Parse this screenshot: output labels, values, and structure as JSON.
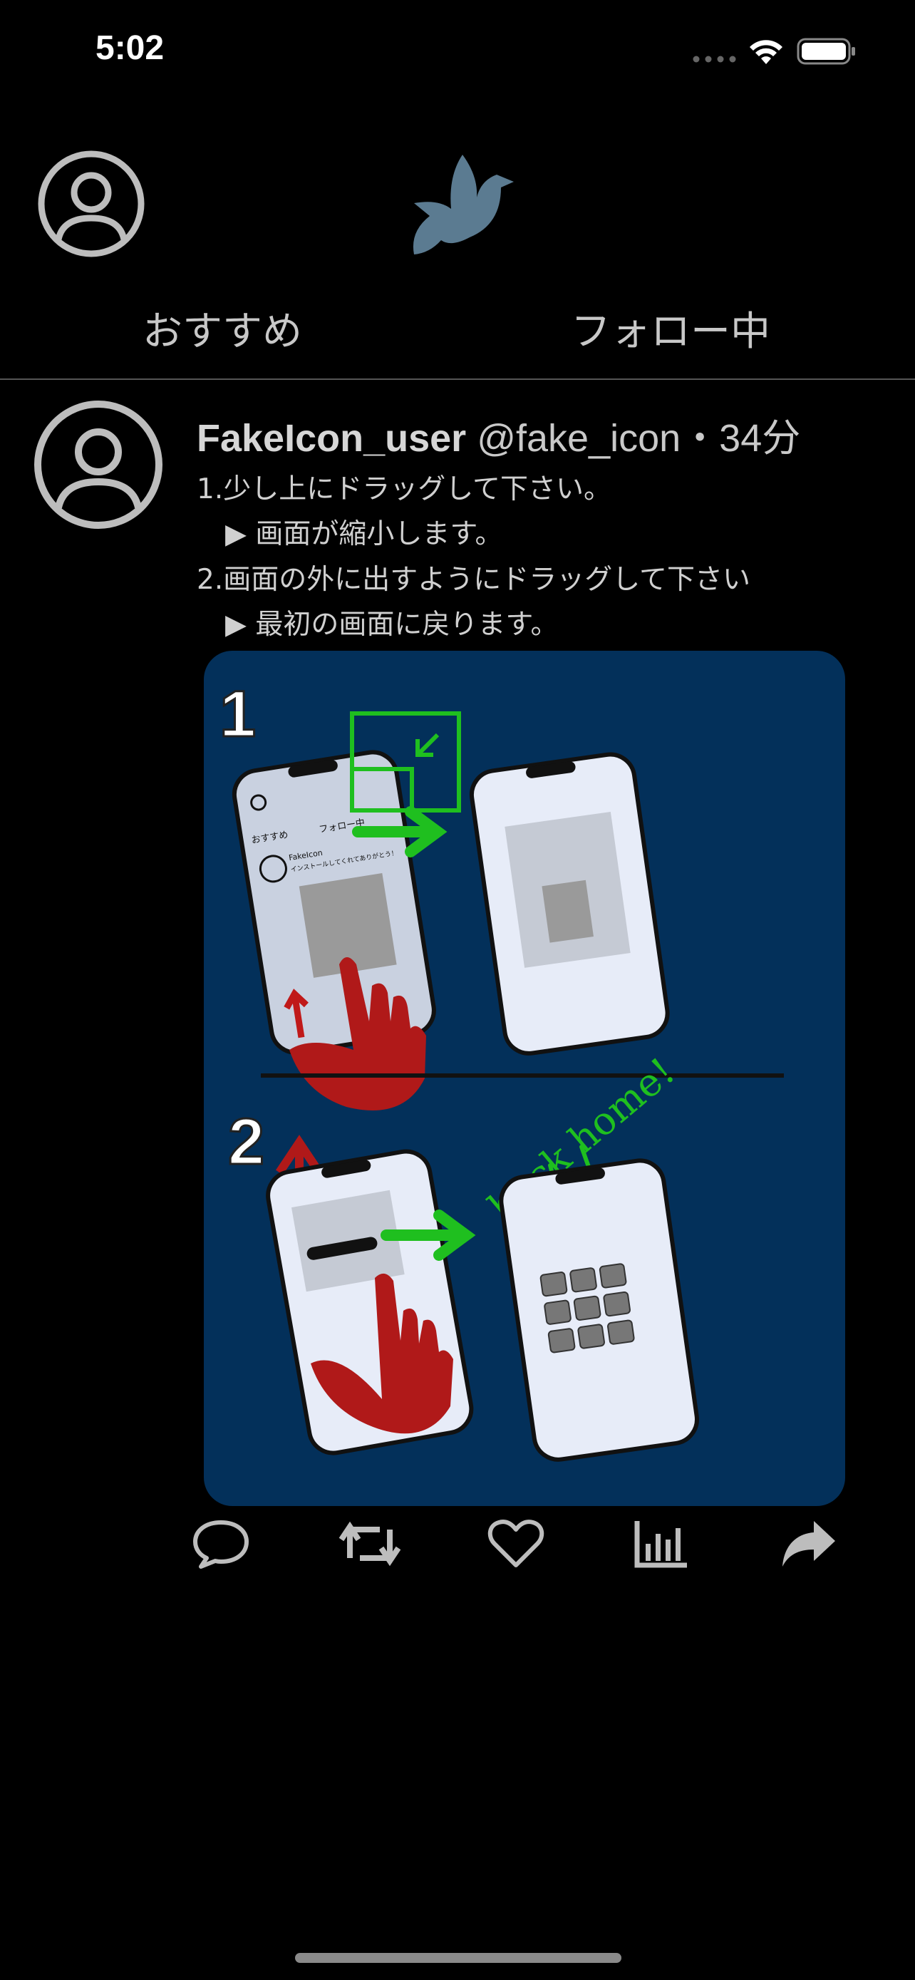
{
  "status_bar": {
    "time": "5:02"
  },
  "header": {
    "tabs": [
      {
        "label": "おすすめ"
      },
      {
        "label": "フォロー中"
      }
    ]
  },
  "post": {
    "username": "FakeIcon_user",
    "handle_time": " @fake_icon・34分",
    "lines": [
      "1.少し上にドラッグして下さい。",
      "▶ 画面が縮小します。",
      "2.画面の外に出すようにドラッグして下さい",
      "▶ 最初の画面に戻ります。"
    ],
    "image": {
      "step1_label": "1",
      "step2_label": "2",
      "back_home_text": "back home!",
      "mini_tab_recommended": "おすすめ",
      "mini_tab_following": "フォロー中",
      "mini_user": "FakeIcon",
      "mini_text": "インストールしてくれてありがとう！"
    },
    "actions": [
      "reply",
      "retweet",
      "like",
      "stats",
      "share"
    ]
  },
  "colors": {
    "background": "#000000",
    "image_background": "#03305a",
    "logo": "#5b7b91",
    "arrow_green": "#1fbf1f",
    "arrow_red": "#b01919"
  }
}
